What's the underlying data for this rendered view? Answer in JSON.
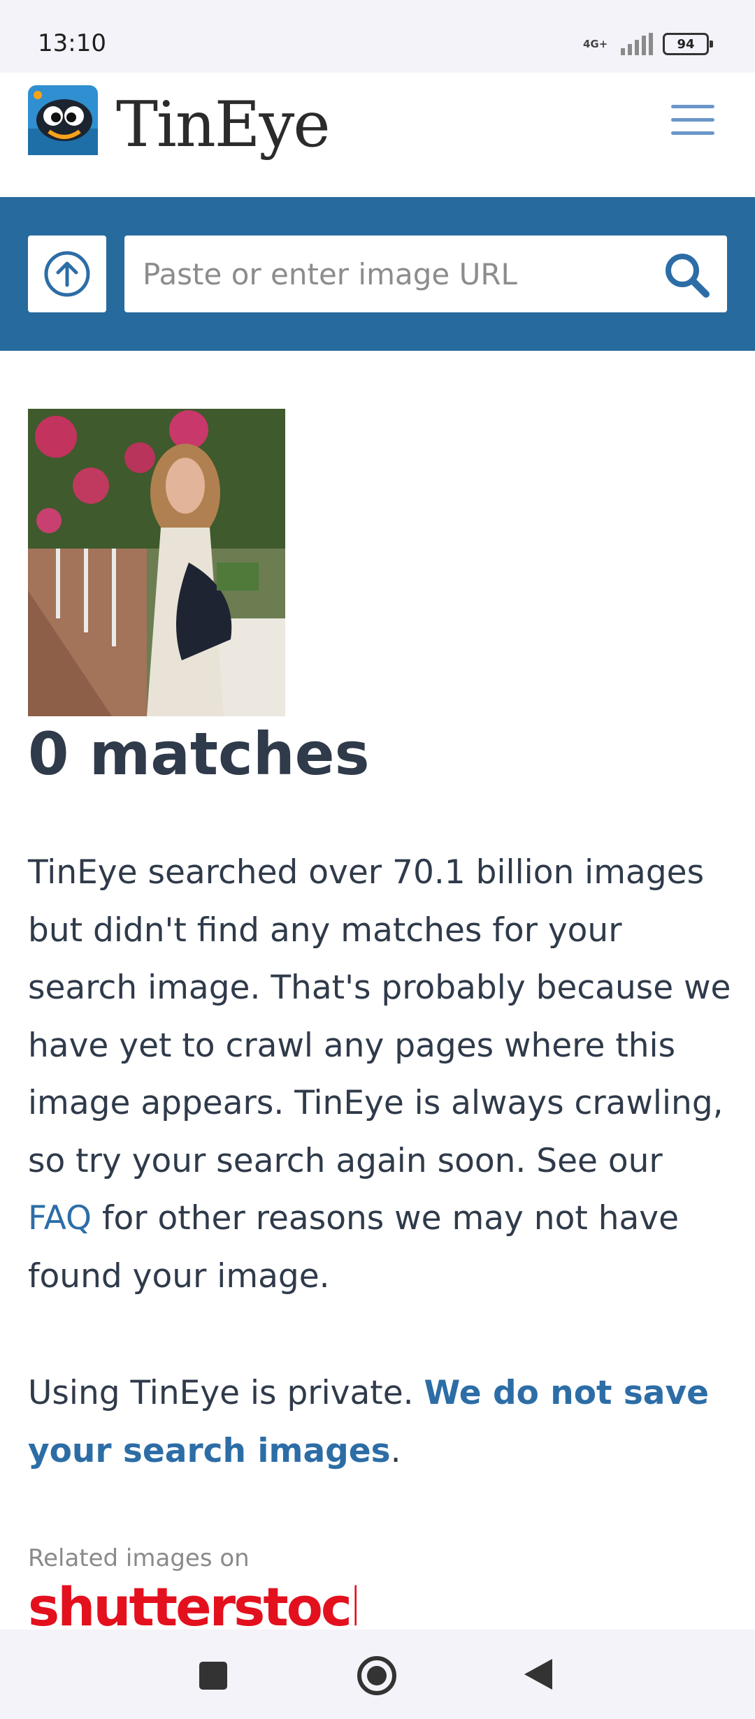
{
  "status_bar": {
    "time": "13:10",
    "network": "4G+",
    "battery": "94"
  },
  "header": {
    "brand": "TinEye",
    "logo_icon": "tineye-robot-icon",
    "menu_icon": "hamburger-menu-icon"
  },
  "search": {
    "url_placeholder": "Paste or enter image URL",
    "upload_icon": "upload-arrow-icon",
    "search_icon": "search-icon"
  },
  "result": {
    "matches_title": "0 matches",
    "body_part1": "TinEye searched over 70.1 billion images but didn't find any matches for your search image. That's probably because we have yet to crawl any pages where this image appears. TinEye is always crawling, so try your search again soon. See our ",
    "faq_link": "FAQ",
    "body_part2": " for other reasons we may not have found your image.",
    "privacy_text": "Using TinEye is private. ",
    "privacy_link": "We do not save your search images",
    "privacy_end": ".",
    "related_label": "Related images on",
    "related_brand": "shutterstock"
  },
  "colors": {
    "accent": "#276a9e",
    "link": "#2c6da6",
    "text": "#2f3a4a"
  }
}
